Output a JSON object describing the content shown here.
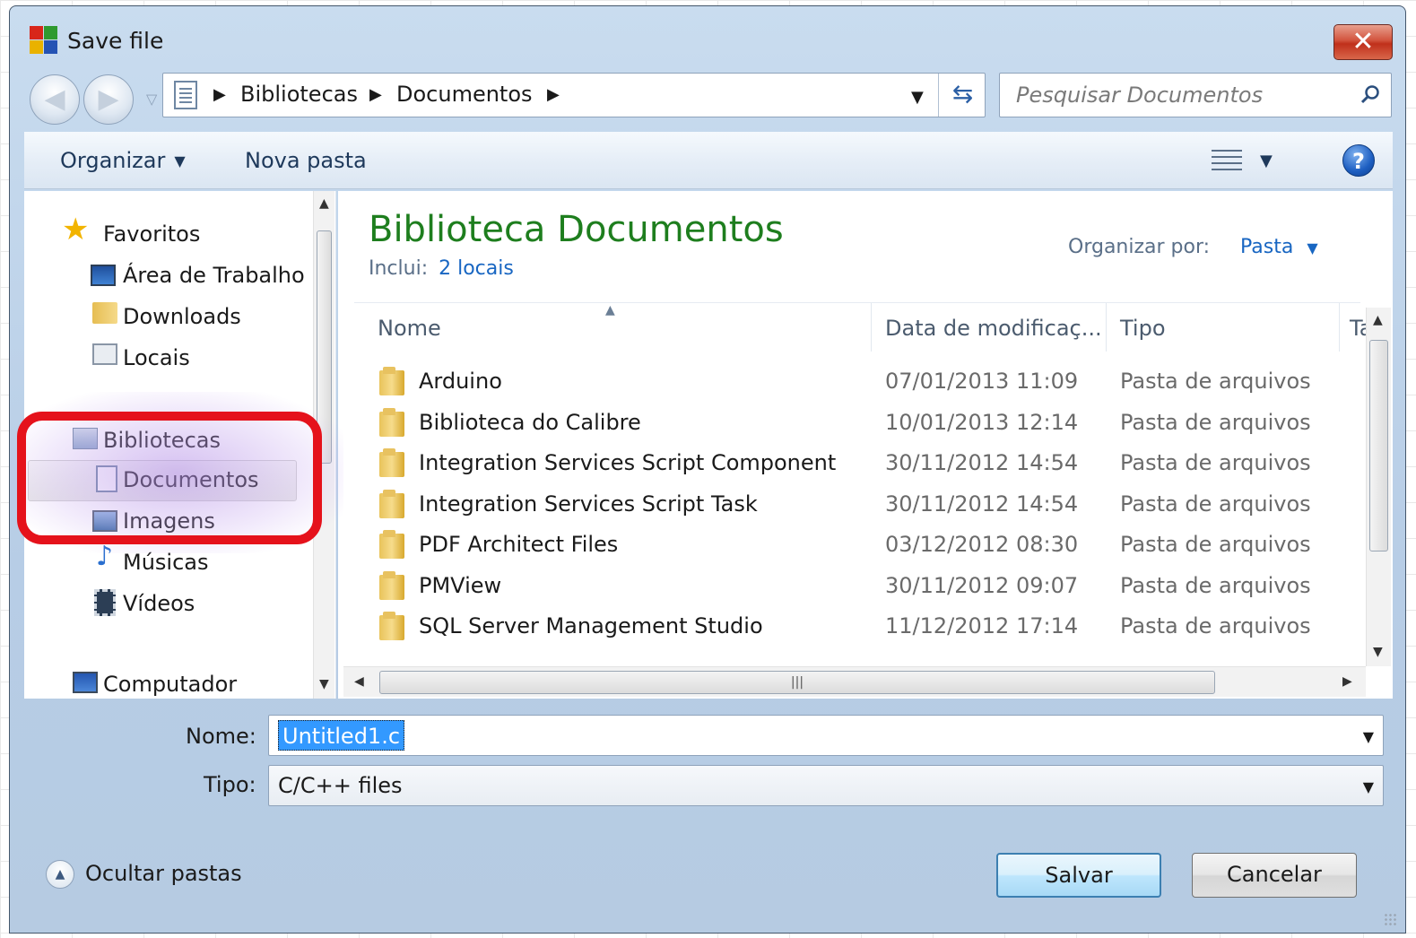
{
  "window": {
    "title": "Save file",
    "close_label": "✕"
  },
  "nav": {
    "breadcrumb": [
      "Bibliotecas",
      "Documentos"
    ],
    "search_placeholder": "Pesquisar Documentos"
  },
  "toolbar": {
    "organize": "Organizar",
    "new_folder": "Nova pasta",
    "help": "?"
  },
  "sidebar": {
    "favorites": {
      "label": "Favoritos",
      "items": [
        "Área de Trabalho",
        "Downloads",
        "Locais"
      ]
    },
    "libraries": {
      "label": "Bibliotecas",
      "items": [
        "Documentos",
        "Imagens",
        "Músicas",
        "Vídeos"
      ],
      "selected": "Documentos"
    },
    "computer": {
      "label": "Computador"
    }
  },
  "library": {
    "title": "Biblioteca Documentos",
    "includes_label": "Inclui:",
    "includes_link": "2 locais",
    "arrange_label": "Organizar por:",
    "arrange_value": "Pasta"
  },
  "columns": {
    "name": "Nome",
    "date": "Data de modificaç...",
    "type": "Tipo",
    "size": "Ta"
  },
  "files": [
    {
      "name": "Arduino",
      "date": "07/01/2013 11:09",
      "type": "Pasta de arquivos"
    },
    {
      "name": "Biblioteca do Calibre",
      "date": "10/01/2013 12:14",
      "type": "Pasta de arquivos"
    },
    {
      "name": "Integration Services Script Component",
      "date": "30/11/2012 14:54",
      "type": "Pasta de arquivos"
    },
    {
      "name": "Integration Services Script Task",
      "date": "30/11/2012 14:54",
      "type": "Pasta de arquivos"
    },
    {
      "name": "PDF Architect Files",
      "date": "03/12/2012 08:30",
      "type": "Pasta de arquivos"
    },
    {
      "name": "PMView",
      "date": "30/11/2012 09:07",
      "type": "Pasta de arquivos"
    },
    {
      "name": "SQL Server Management Studio",
      "date": "11/12/2012 17:14",
      "type": "Pasta de arquivos"
    }
  ],
  "form": {
    "name_label": "Nome:",
    "name_value": "Untitled1.c",
    "type_label": "Tipo:",
    "type_value": "C/C++ files"
  },
  "footer": {
    "hide_folders": "Ocultar pastas",
    "save": "Salvar",
    "cancel": "Cancelar"
  },
  "colors": {
    "accent_green": "#1e7e1e",
    "link_blue": "#1866c2",
    "callout_red": "#e5121b",
    "selection_blue": "#3399ff"
  }
}
